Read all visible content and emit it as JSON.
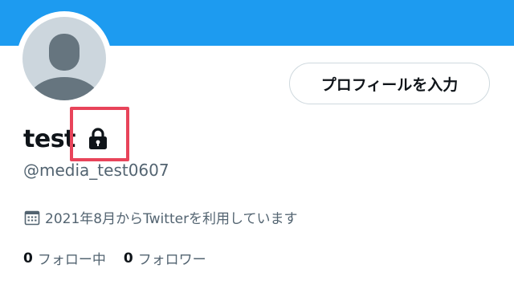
{
  "profile": {
    "display_name": "test",
    "handle": "@media_test0607",
    "joined": "2021年8月からTwitterを利用しています",
    "edit_button_label": "プロフィールを入力",
    "following_count": "0",
    "following_label": "フォロー中",
    "followers_count": "0",
    "followers_label": "フォロワー"
  },
  "icons": {
    "lock": "lock-icon",
    "calendar": "calendar-icon",
    "avatar": "default-avatar"
  },
  "colors": {
    "banner": "#1d9bf0",
    "highlight": "#e8445a",
    "secondary_text": "#536471",
    "primary_text": "#0f1419"
  }
}
